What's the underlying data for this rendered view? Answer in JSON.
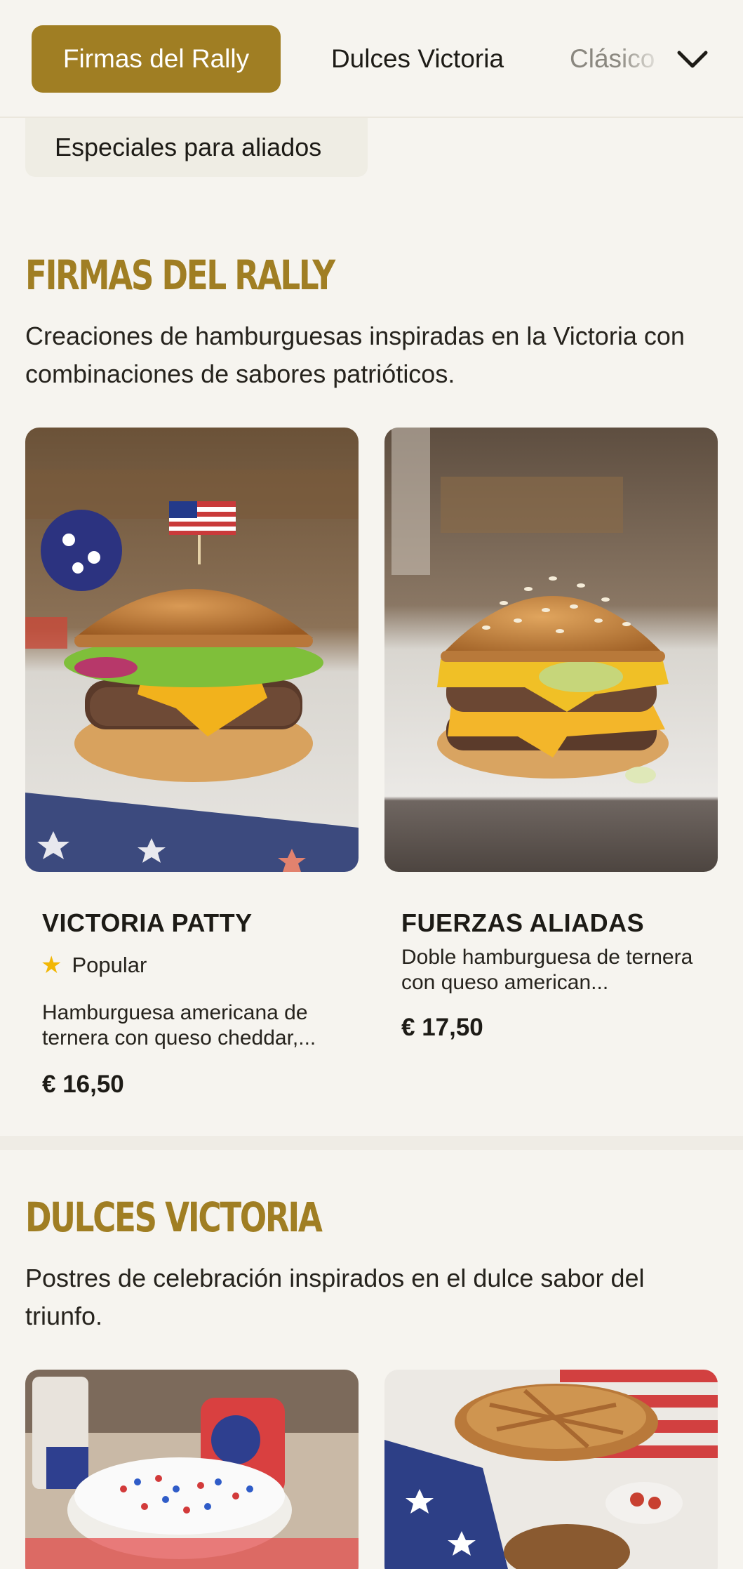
{
  "categories": {
    "items": [
      "Firmas del Rally",
      "Dulces Victoria",
      "Clásicos",
      "Especiales para aliados"
    ],
    "active_index": 0
  },
  "sections": [
    {
      "title": "FIRMAS DEL RALLY",
      "description": "Creaciones de hamburguesas inspiradas en la Victoria con combinaciones de sabores patrióticos.",
      "items": [
        {
          "name": "VICTORIA PATTY",
          "badge": "Popular",
          "badge_icon": "star-icon",
          "description": "Hamburguesa americana de ternera con queso cheddar,...",
          "price": "€ 16,50"
        },
        {
          "name": "FUERZAS ALIADAS",
          "description": "Doble hamburguesa de ternera con queso american...",
          "price": "€ 17,50"
        }
      ]
    },
    {
      "title": "DULCES VICTORIA",
      "description": "Postres de celebración inspirados en el dulce sabor del triunfo."
    }
  ],
  "colors": {
    "accent": "#a07e23",
    "background": "#f6f4ef",
    "star": "#f2b705"
  }
}
